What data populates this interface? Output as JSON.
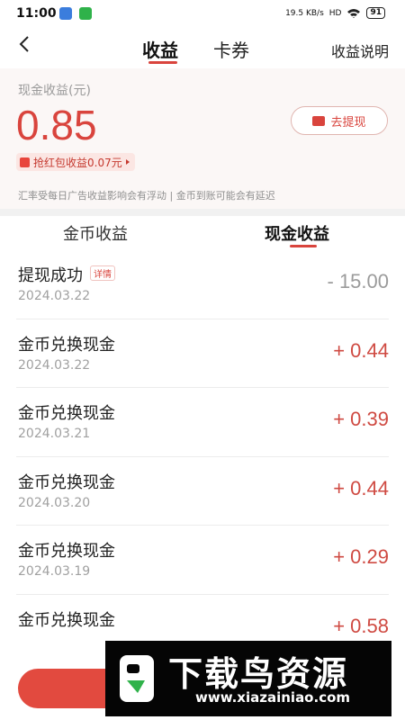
{
  "status_bar": {
    "time": "11:00",
    "net_speed": "19.5 KB/s",
    "signal": "HD",
    "battery": "91"
  },
  "header": {
    "tabs": [
      {
        "label": "收益",
        "active": true
      },
      {
        "label": "卡券",
        "active": false
      }
    ],
    "explain_label": "收益说明"
  },
  "summary": {
    "cash_label": "现金收益(元)",
    "cash_amount": "0.85",
    "withdraw_label": "去提现",
    "redpack_label": "抢红包收益0.07元",
    "notice": "汇率受每日广告收益影响会有浮动 | 金币到账可能会有延迟"
  },
  "subtabs": [
    {
      "label": "金币收益",
      "active": false
    },
    {
      "label": "现金收益",
      "active": true
    }
  ],
  "records": [
    {
      "title": "提现成功",
      "tag": "详情",
      "date": "2024.03.22",
      "amount": "- 15.00",
      "type": "neg"
    },
    {
      "title": "金币兑换现金",
      "date": "2024.03.22",
      "amount": "+ 0.44",
      "type": "pos"
    },
    {
      "title": "金币兑换现金",
      "date": "2024.03.21",
      "amount": "+ 0.39",
      "type": "pos"
    },
    {
      "title": "金币兑换现金",
      "date": "2024.03.20",
      "amount": "+ 0.44",
      "type": "pos"
    },
    {
      "title": "金币兑换现金",
      "date": "2024.03.19",
      "amount": "+ 0.29",
      "type": "pos"
    },
    {
      "title": "金币兑换现金",
      "date": "",
      "amount": "+ 0.58",
      "type": "pos"
    }
  ],
  "watermark": {
    "title": "下载鸟资源",
    "url": "www.xiazainiao.com"
  },
  "colors": {
    "accent": "#d9443d",
    "negative": "#9b9b9b",
    "summary_bg": "#fbf7f6"
  }
}
